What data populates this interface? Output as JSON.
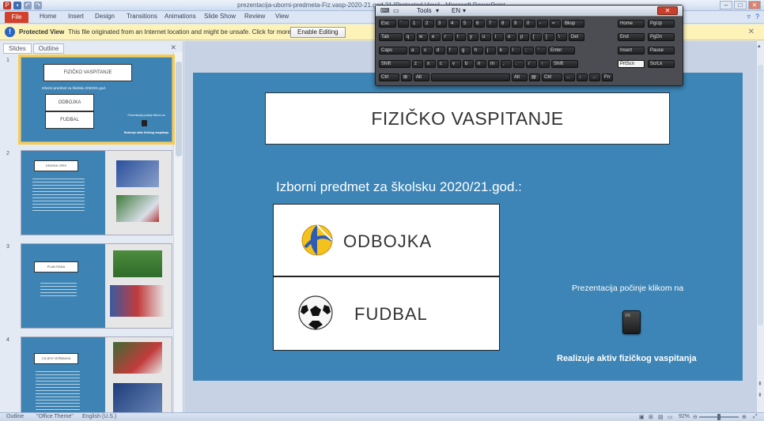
{
  "window": {
    "title": "prezentacija-uborni-predmeta-Fiz.vasp-2020-21.god.21 [Protected View] - Microsoft PowerPoint"
  },
  "ribbon": {
    "tabs": [
      "File",
      "Home",
      "Insert",
      "Design",
      "Transitions",
      "Animations",
      "Slide Show",
      "Review",
      "View"
    ]
  },
  "protected_view": {
    "title": "Protected View",
    "message": "This file originated from an Internet location and might be unsafe. Click for more details.",
    "enable_button": "Enable Editing"
  },
  "panel": {
    "tabs": [
      "Slides",
      "Outline"
    ],
    "thumbnails": [
      {
        "number": "1",
        "title": "FIZIČKO VASPITANJE",
        "subtitle": "Izborni predmet za školsku 2020/21.god.",
        "items": [
          "ODBOJKA",
          "FUDBAL"
        ],
        "note": "Prezentacija počinje klikom na",
        "footer": "Realizuje aktiv fizičkog vaspitanja"
      },
      {
        "number": "2",
        "title": "KRATAK OPIS"
      },
      {
        "number": "3",
        "title": "PLAN RADA"
      },
      {
        "number": "4",
        "title": "CILJEVI VEŽBANJA"
      }
    ]
  },
  "slide": {
    "title": "FIZIČKO VASPITANJE",
    "subtitle": "Izborni predmet za školsku 2020/21.god.:",
    "sports": [
      "ODBOJKA",
      "FUDBAL"
    ],
    "intro": "Prezentacija počinje klikom na",
    "key_label": "F5",
    "footer": "Realizuje aktiv fizičkog vaspitanja"
  },
  "keyboard": {
    "toolbar": {
      "tools": "Tools",
      "lang": "EN"
    },
    "rows": [
      [
        "Esc",
        "`",
        "1",
        "2",
        "3",
        "4",
        "5",
        "6",
        "7",
        "8",
        "9",
        "0",
        "-",
        "=",
        "Bksp",
        "Home",
        "PgUp"
      ],
      [
        "Tab",
        "q",
        "w",
        "e",
        "r",
        "t",
        "y",
        "u",
        "i",
        "o",
        "p",
        "[",
        "]",
        "\\",
        "Del",
        "End",
        "PgDn"
      ],
      [
        "Caps",
        "a",
        "s",
        "d",
        "f",
        "g",
        "h",
        "j",
        "k",
        "l",
        ";",
        "'",
        "Enter",
        "Insert",
        "Pause"
      ],
      [
        "Shift",
        "z",
        "x",
        "c",
        "v",
        "b",
        "n",
        "m",
        ",",
        ".",
        "/",
        "↑",
        "Shift",
        "PrtScn",
        "ScrLk"
      ],
      [
        "Ctrl",
        "⊞",
        "Alt",
        "",
        "Alt",
        "▤",
        "Ctrl",
        "←",
        "↓",
        "→",
        "Fn"
      ]
    ]
  },
  "status": {
    "outline": "Outline",
    "theme": "\"Office Theme\"",
    "language": "English (U.S.)",
    "zoom": "92%"
  },
  "colors": {
    "slide_bg": "#3c85b6",
    "file_tab": "#d2412a",
    "protected_bar": "#fdf3b8",
    "selection": "#f6cd4c"
  }
}
